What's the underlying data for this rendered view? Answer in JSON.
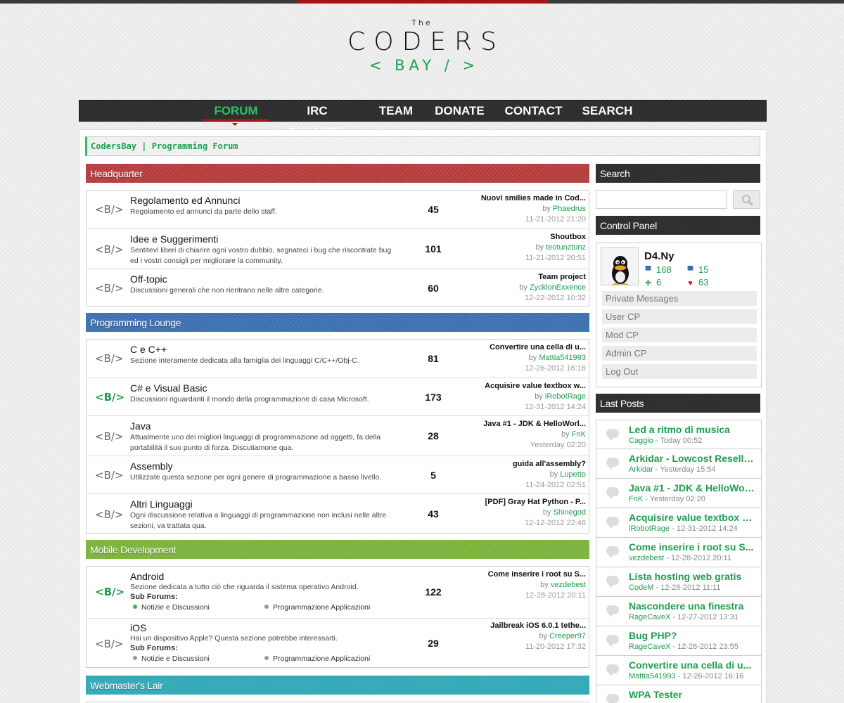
{
  "brand": {
    "the": "The",
    "coders": "CODERS",
    "bay": "< BAY / >"
  },
  "nav": [
    "FORUM",
    "IRC CHANNEL",
    "TEAM",
    "DONATE",
    "CONTACT",
    "SEARCH"
  ],
  "breadcrumb": "CodersBay | Programming Forum",
  "icon_label": "<B/>",
  "colors": {
    "accent": "#1e9e4f",
    "headquarter": "#b53b3b",
    "lounge": "#3a6fb0",
    "mobile": "#7ab33a",
    "webmaster": "#2fa8b5"
  },
  "categories": [
    {
      "title": "Headquarter",
      "forums": [
        {
          "title": "Regolamento ed Annunci",
          "desc": "Regolamento ed annunci da parte dello staff.",
          "count": "45",
          "last_title": "Nuovi smilies made in Cod...",
          "last_by": "Phaedrus",
          "last_date": "11-21-2012 21:20"
        },
        {
          "title": "Idee e Suggerimenti",
          "desc": "Sentitevi liberi di chiarire ogni vostro dubbio, segnateci i bug che riscontrate bug ed i vostri consigli per migliorare la community.",
          "count": "101",
          "last_title": "Shoutbox",
          "last_by": "teotunztunz",
          "last_date": "11-21-2012 20:51"
        },
        {
          "title": "Off-topic",
          "desc": "Discussioni generali che non rientrano nelle altre categorie.",
          "count": "60",
          "last_title": "Team project",
          "last_by": "ZycklonExxence",
          "last_date": "12-22-2012 10:32"
        }
      ]
    },
    {
      "title": "Programming Lounge",
      "forums": [
        {
          "title": "C e C++",
          "desc": "Sezione interamente dedicata alla famiglia dei linguaggi C/C++/Obj-C.",
          "count": "81",
          "last_title": "Convertire una cella di u...",
          "last_by": "Mattia541993",
          "last_date": "12-26-2012 16:16"
        },
        {
          "title": "C# e Visual Basic",
          "desc": "Discussioni riguardanti il mondo della programmazione di casa Microsoft.",
          "count": "173",
          "last_title": "Acquisire value textbox w...",
          "last_by": "iRobotRage",
          "last_date": "12-31-2012 14:24"
        },
        {
          "title": "Java",
          "desc": "Attualmente uno dei migliori linguaggi di programmazione ad oggetti, fa della portabilità il suo punto di forza. Discutiamone qua.",
          "count": "28",
          "last_title": "Java #1 - JDK & HelloWorl...",
          "last_by": "FnK",
          "last_date": "Yesterday 02:20"
        },
        {
          "title": "Assembly",
          "desc": "Utilizzate questa sezione per ogni genere di programmazione a basso livello.",
          "count": "5",
          "last_title": "guida all'assembly?",
          "last_by": "Lupetto",
          "last_date": "11-24-2012 02:51"
        },
        {
          "title": "Altri Linguaggi",
          "desc": "Ogni discussione relativa a linguaggi di programmazione non inclusi nelle altre sezioni, va trattata qua.",
          "count": "43",
          "last_title": "[PDF] Gray Hat Python - P...",
          "last_by": "Shinegod",
          "last_date": "12-12-2012 22:46"
        }
      ]
    },
    {
      "title": "Mobile Development",
      "forums": [
        {
          "title": "Android",
          "desc": "Sezione dedicata a tutto ciò che riguarda il sistema operativo Android.",
          "count": "122",
          "last_title": "Come inserire i root su S...",
          "last_by": "vezdebest",
          "last_date": "12-28-2012 20:11",
          "sub_label": "Sub Forums:",
          "subs": [
            "Notizie e Discussioni",
            "Programmazione Applicazioni"
          ]
        },
        {
          "title": "iOS",
          "desc": "Hai un dispositivo Apple? Questa sezione potrebbe interessarti.",
          "count": "29",
          "last_title": "Jailbreak iOS 6.0.1 tethe...",
          "last_by": "Creeper97",
          "last_date": "11-20-2012 17:32",
          "sub_label": "Sub Forums:",
          "subs": [
            "Notizie e Discussioni",
            "Programmazione Applicazioni"
          ]
        }
      ]
    },
    {
      "title": "Webmaster's Lair",
      "forums": []
    }
  ],
  "by_label": "by",
  "sidebar": {
    "search_title": "Search",
    "control_title": "Control Panel",
    "user": {
      "name": "D4.Ny",
      "stats": [
        "168",
        "15",
        "6",
        "63"
      ]
    },
    "links": [
      "Private Messages",
      "User CP",
      "Mod CP",
      "Admin CP",
      "Log Out"
    ],
    "last_posts_title": "Last Posts",
    "last_posts": [
      {
        "title": "Led a ritmo di musica",
        "by": "Caggio",
        "date": "Today 00:52"
      },
      {
        "title": "Arkidar - Lowcost Reselle...",
        "by": "Arkidar",
        "date": "Yesterday 15:54"
      },
      {
        "title": "Java #1 - JDK & HelloWorl...",
        "by": "FnK",
        "date": "Yesterday 02:20"
      },
      {
        "title": "Acquisire value textbox w...",
        "by": "iRobotRage",
        "date": "12-31-2012 14:24"
      },
      {
        "title": "Come inserire i root su S...",
        "by": "vezdebest",
        "date": "12-28-2012 20:11"
      },
      {
        "title": "Lista hosting web gratis",
        "by": "CodeM",
        "date": "12-28-2012 11:11"
      },
      {
        "title": "Nascondere una finestra",
        "by": "RageCaveX",
        "date": "12-27-2012 13:31"
      },
      {
        "title": "Bug PHP?",
        "by": "RageCaveX",
        "date": "12-26-2012 23:55"
      },
      {
        "title": "Convertire una cella di u...",
        "by": "Mattia541993",
        "date": "12-26-2012 16:16"
      },
      {
        "title": "WPA Tester",
        "by": "",
        "date": ""
      }
    ]
  }
}
